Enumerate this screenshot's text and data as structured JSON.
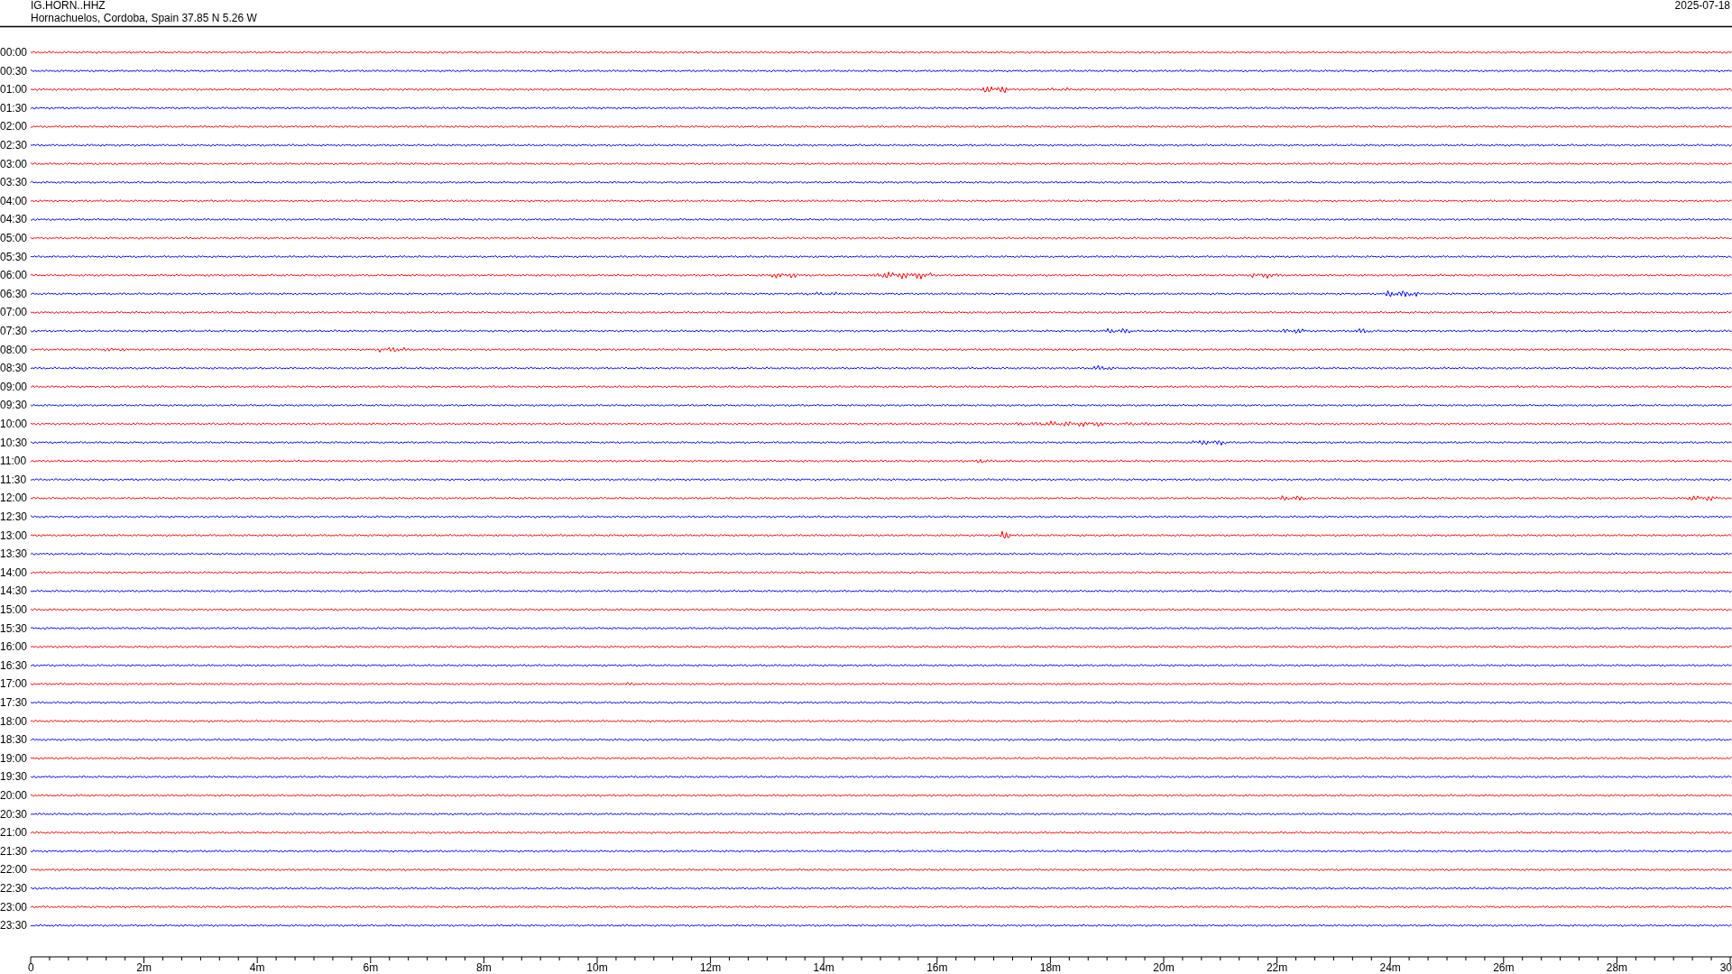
{
  "header": {
    "station": "IG.HORN..HHZ",
    "location": "Hornachuelos, Cordoba, Spain  37.85 N 5.26 W",
    "date": "2025-07-18"
  },
  "rows": [
    {
      "label": "00:00",
      "color": "#ff0000"
    },
    {
      "label": "00:30",
      "color": "#0000ff"
    },
    {
      "label": "01:00",
      "color": "#ff0000"
    },
    {
      "label": "01:30",
      "color": "#0000ff"
    },
    {
      "label": "02:00",
      "color": "#ff0000"
    },
    {
      "label": "02:30",
      "color": "#0000ff"
    },
    {
      "label": "03:00",
      "color": "#ff0000"
    },
    {
      "label": "03:30",
      "color": "#0000ff"
    },
    {
      "label": "04:00",
      "color": "#ff0000"
    },
    {
      "label": "04:30",
      "color": "#0000ff"
    },
    {
      "label": "05:00",
      "color": "#ff0000"
    },
    {
      "label": "05:30",
      "color": "#0000ff"
    },
    {
      "label": "06:00",
      "color": "#ff0000"
    },
    {
      "label": "06:30",
      "color": "#0000ff"
    },
    {
      "label": "07:00",
      "color": "#ff0000"
    },
    {
      "label": "07:30",
      "color": "#0000ff"
    },
    {
      "label": "08:00",
      "color": "#ff0000"
    },
    {
      "label": "08:30",
      "color": "#0000ff"
    },
    {
      "label": "09:00",
      "color": "#ff0000"
    },
    {
      "label": "09:30",
      "color": "#0000ff"
    },
    {
      "label": "10:00",
      "color": "#ff0000"
    },
    {
      "label": "10:30",
      "color": "#0000ff"
    },
    {
      "label": "11:00",
      "color": "#ff0000"
    },
    {
      "label": "11:30",
      "color": "#0000ff"
    },
    {
      "label": "12:00",
      "color": "#ff0000"
    },
    {
      "label": "12:30",
      "color": "#0000ff"
    },
    {
      "label": "13:00",
      "color": "#ff0000"
    },
    {
      "label": "13:30",
      "color": "#0000ff"
    },
    {
      "label": "14:00",
      "color": "#ff0000"
    },
    {
      "label": "14:30",
      "color": "#0000ff"
    },
    {
      "label": "15:00",
      "color": "#ff0000"
    },
    {
      "label": "15:30",
      "color": "#0000ff"
    },
    {
      "label": "16:00",
      "color": "#ff0000"
    },
    {
      "label": "16:30",
      "color": "#0000ff"
    },
    {
      "label": "17:00",
      "color": "#ff0000"
    },
    {
      "label": "17:30",
      "color": "#0000ff"
    },
    {
      "label": "18:00",
      "color": "#ff0000"
    },
    {
      "label": "18:30",
      "color": "#0000ff"
    },
    {
      "label": "19:00",
      "color": "#ff0000"
    },
    {
      "label": "19:30",
      "color": "#0000ff"
    },
    {
      "label": "20:00",
      "color": "#ff0000"
    },
    {
      "label": "20:30",
      "color": "#0000ff"
    },
    {
      "label": "21:00",
      "color": "#ff0000"
    },
    {
      "label": "21:30",
      "color": "#0000ff"
    },
    {
      "label": "22:00",
      "color": "#ff0000"
    },
    {
      "label": "22:30",
      "color": "#0000ff"
    },
    {
      "label": "23:00",
      "color": "#ff0000"
    },
    {
      "label": "23:30",
      "color": "#0000ff"
    }
  ],
  "x_axis": {
    "labels": [
      "0",
      "2m",
      "4m",
      "6m",
      "8m",
      "10m",
      "12m",
      "14m",
      "16m",
      "18m",
      "20m",
      "22m",
      "24m",
      "26m",
      "28m",
      "30"
    ]
  }
}
